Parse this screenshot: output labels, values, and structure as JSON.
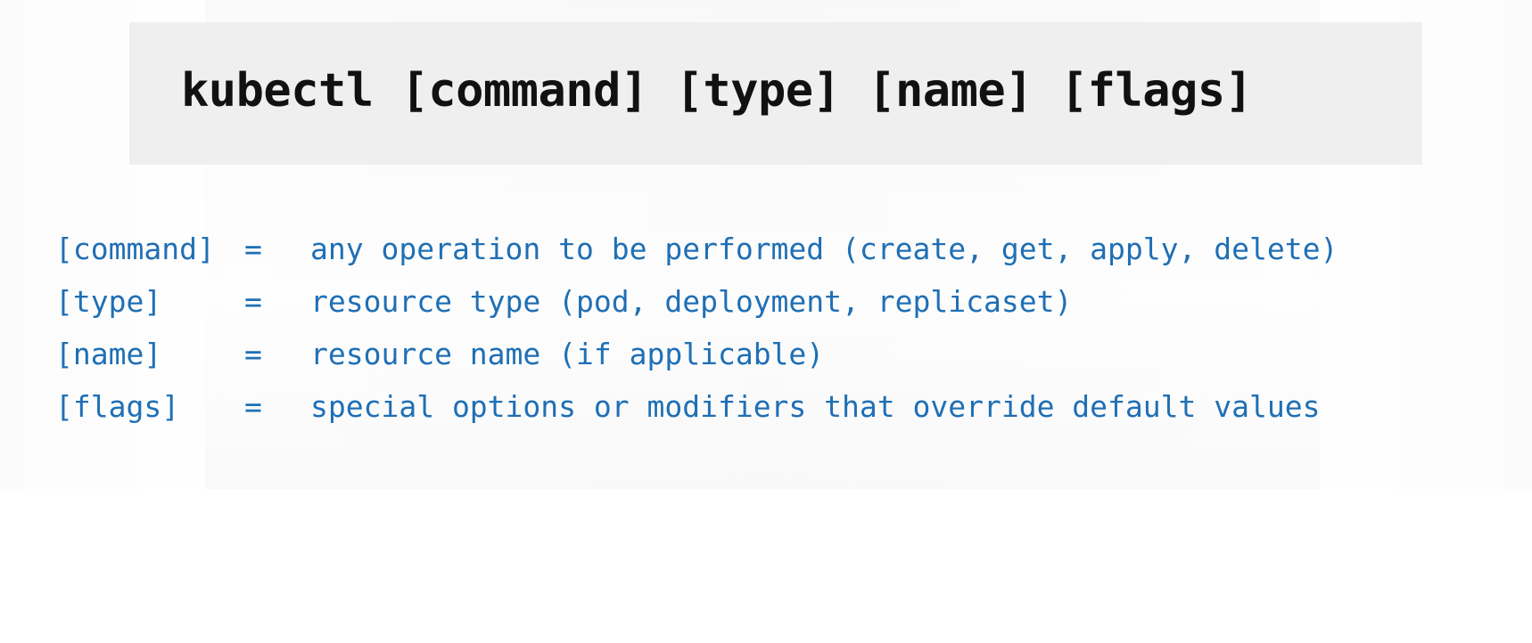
{
  "syntax": {
    "command_line": "kubectl [command] [type] [name] [flags]"
  },
  "definitions": [
    {
      "term": "[command]",
      "equals": "=",
      "description": "any operation to be performed (create, get, apply, delete)"
    },
    {
      "term": "[type]",
      "equals": "=",
      "description": "resource type (pod, deployment, replicaset)"
    },
    {
      "term": "[name]",
      "equals": "=",
      "description": "resource name (if applicable)"
    },
    {
      "term": "[flags]",
      "equals": "=",
      "description": "special options or modifiers that override default values"
    }
  ],
  "colors": {
    "syntax_text": "#111111",
    "banner_background": "#efefef",
    "definition_text": "#1f6fb5"
  }
}
